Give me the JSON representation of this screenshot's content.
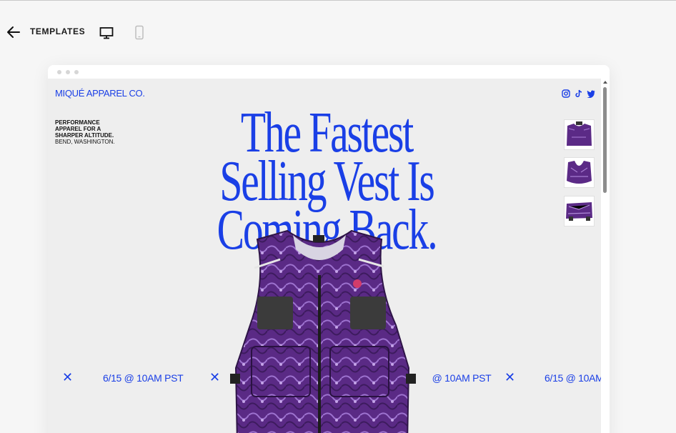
{
  "toolbar": {
    "back_icon": "arrow-left-icon",
    "templates_label": "TEMPLATES",
    "desktop_icon": "desktop-monitor-icon",
    "mobile_icon": "mobile-phone-icon"
  },
  "site": {
    "brand": "MIQUÉ APPAREL CO.",
    "social_icons": [
      "instagram-icon",
      "tiktok-icon",
      "twitter-icon"
    ],
    "tagline_line1": "PERFORMANCE",
    "tagline_line2": "APPAREL FOR A",
    "tagline_line3": "SHARPER ALTITUDE.",
    "location": "BEND, WASHINGTON.",
    "headline_line1": "The Fastest",
    "headline_line2": "Selling Vest Is",
    "headline_line3": "Coming Back.",
    "ticker": [
      "6/15 @ 10AM PST",
      "6/15 @ 10AM PST",
      "6/15 @ 10AM"
    ],
    "ticker_separator": "✕",
    "thumbnail_count": 3
  },
  "colors": {
    "accent": "#1a3fe6",
    "background": "#eeeeee",
    "vest_purple": "#5b2a86"
  }
}
